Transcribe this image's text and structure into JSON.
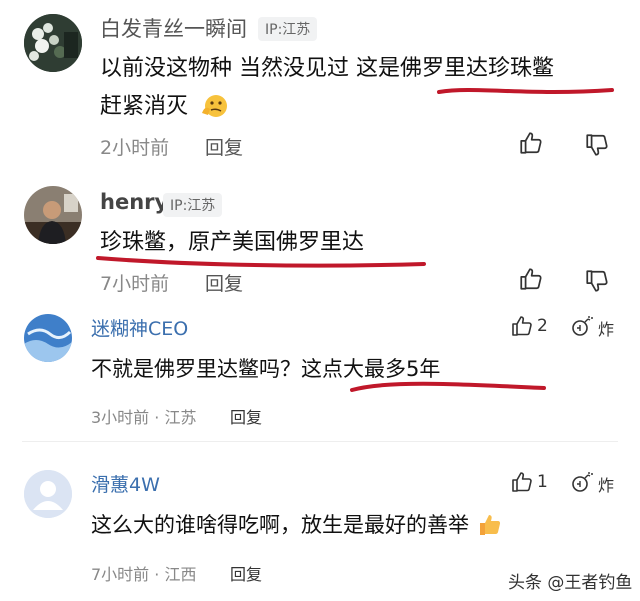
{
  "comments": [
    {
      "username": "白发青丝一瞬间",
      "ip": "IP:江苏",
      "content_line1": "以前没这物种 当然没见过 这是佛罗里达珍珠鳖",
      "content_line2": "赶紧消灭",
      "time": "2小时前",
      "reply": "回复"
    },
    {
      "username": "henry",
      "ip": "IP:江苏",
      "content": "珍珠鳖，原产美国佛罗里达",
      "time": "7小时前",
      "reply": "回复"
    },
    {
      "username": "迷糊神CEO",
      "content": "不就是佛罗里达鳖吗？这点大最多5年",
      "time": "3小时前 · 江苏",
      "reply": "回复",
      "likes": "2",
      "action": "炸"
    },
    {
      "username": "滑蕙4W",
      "content": "这么大的谁啥得吃啊，放生是最好的善举",
      "time": "7小时前 · 江西",
      "reply": "回复",
      "likes": "1",
      "action": "炸"
    }
  ],
  "watermark": "头条 @王者钓鱼",
  "colors": {
    "underline": "#c0182a",
    "blue_name": "#3b6fae",
    "gray_meta": "#888888"
  },
  "icons": [
    "thumb-up-icon",
    "thumb-down-icon",
    "bomb-icon",
    "thinking-emoji-icon",
    "thumbs-up-emoji-icon"
  ]
}
